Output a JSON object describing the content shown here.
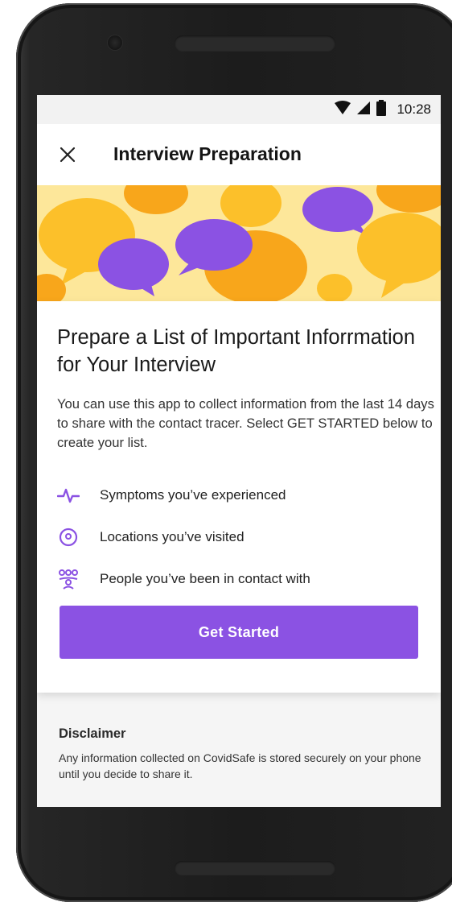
{
  "status_bar": {
    "time": "10:28",
    "icons": [
      "wifi-icon",
      "cell-signal-icon",
      "battery-icon"
    ]
  },
  "app_bar": {
    "close_icon": "close-icon",
    "title": "Interview Preparation"
  },
  "card": {
    "heading": "Prepare a List of Important Inforrmation for Your Interview",
    "body": "You can use this app to collect information from the last 14 days to share with the contact tracer. Select GET STARTED below to create your list.",
    "items": [
      {
        "icon": "heartbeat-icon",
        "label": "Symptoms you’ve experienced"
      },
      {
        "icon": "location-pin-icon",
        "label": "Locations you’ve visited"
      },
      {
        "icon": "people-icon",
        "label": "People you’ve been in contact with"
      }
    ],
    "button_label": "Get Started"
  },
  "disclaimer": {
    "title": "Disclaimer",
    "text": "Any information collected on CovidSafe is stored securely on your phone until you decide to share it."
  },
  "colors": {
    "accent": "#8b52e3",
    "hero_background": "#fde79a",
    "bubble_yellow": "#fcc02a",
    "bubble_orange": "#f8a61b",
    "bubble_purple": "#8b52e3"
  }
}
